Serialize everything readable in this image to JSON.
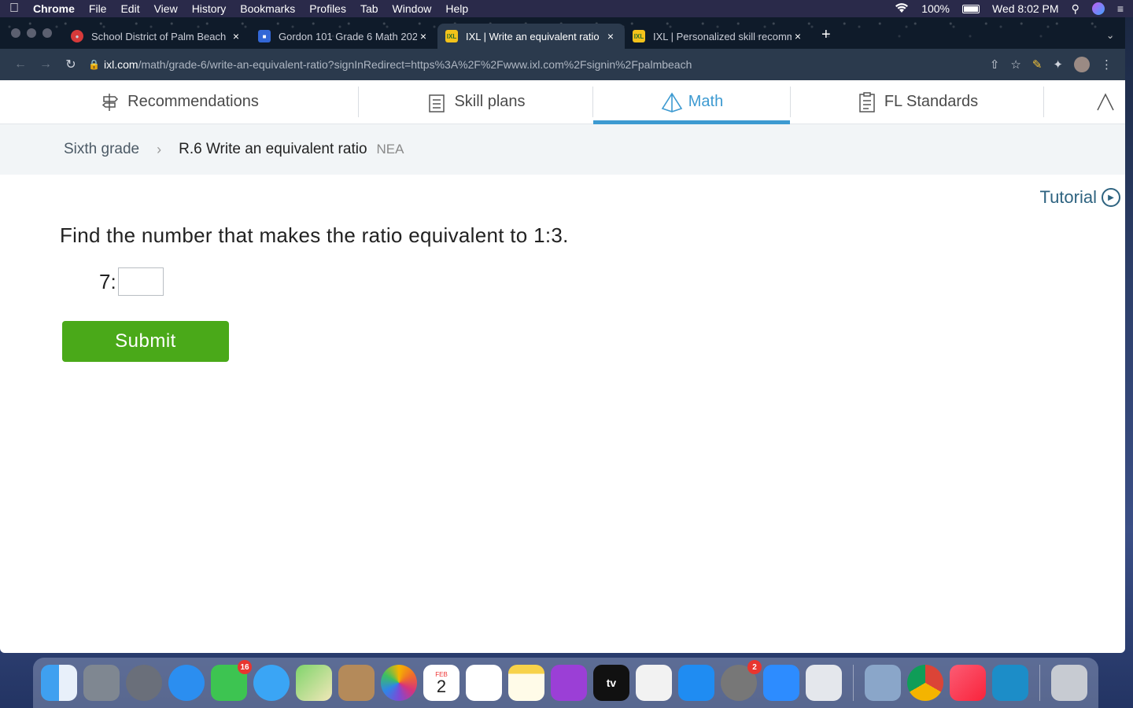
{
  "menubar": {
    "app": "Chrome",
    "items": [
      "File",
      "Edit",
      "View",
      "History",
      "Bookmarks",
      "Profiles",
      "Tab",
      "Window",
      "Help"
    ],
    "battery": "100%",
    "clock": "Wed 8:02 PM"
  },
  "tabs": [
    {
      "title": "School District of Palm Beach",
      "icon": "palm-beach-favicon",
      "color": "#d63a3a"
    },
    {
      "title": "Gordon 101 Grade 6 Math 202",
      "icon": "classroom-favicon",
      "color": "#3367d6"
    },
    {
      "title": "IXL | Write an equivalent ratio",
      "icon": "ixl-favicon",
      "color": "#f4c21a"
    },
    {
      "title": "IXL | Personalized skill recomm",
      "icon": "ixl-favicon",
      "color": "#f4c21a"
    }
  ],
  "address": {
    "host": "ixl.com",
    "path": "/math/grade-6/write-an-equivalent-ratio?signInRedirect=https%3A%2F%2Fwww.ixl.com%2Fsignin%2Fpalmbeach"
  },
  "subnav": {
    "recommendations": "Recommendations",
    "skill_plans": "Skill plans",
    "math": "Math",
    "fl_standards": "FL Standards"
  },
  "breadcrumb": {
    "grade": "Sixth grade",
    "skill": "R.6 Write an equivalent ratio",
    "code": "NEA"
  },
  "tutorial": "Tutorial",
  "question": {
    "prompt": "Find the number that makes the ratio equivalent to 1:3.",
    "left_term": "7:",
    "answer_value": "",
    "submit": "Submit"
  },
  "dock": {
    "facetime_badge": "16",
    "calendar_month": "FEB",
    "calendar_day": "2",
    "prefs_badge": "2",
    "tv_label": "tv"
  },
  "colors": {
    "accent": "#3d9ad1",
    "submit": "#4aa919"
  }
}
